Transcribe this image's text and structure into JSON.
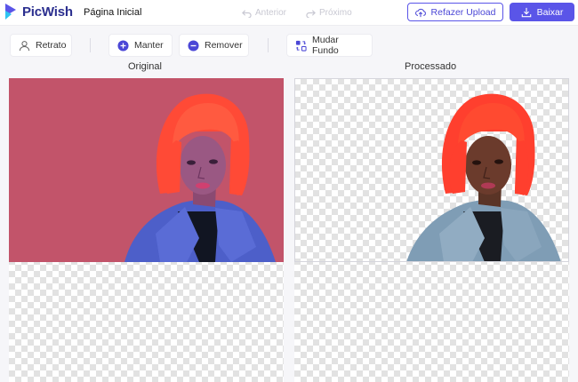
{
  "header": {
    "brand": "PicWish",
    "home_label": "Página Inicial",
    "prev_label": "Anterior",
    "next_label": "Próximo",
    "reupload_label": "Refazer Upload",
    "download_label": "Baixar"
  },
  "toolbar": {
    "portrait_label": "Retrato",
    "keep_label": "Manter",
    "remove_label": "Remover",
    "change_bg_label": "Mudar Fundo"
  },
  "panels": {
    "original_title": "Original",
    "processed_title": "Processado"
  },
  "colors": {
    "accent": "#5a55e8",
    "original_background": "#c2546a",
    "hair": "#ff3f2e"
  }
}
